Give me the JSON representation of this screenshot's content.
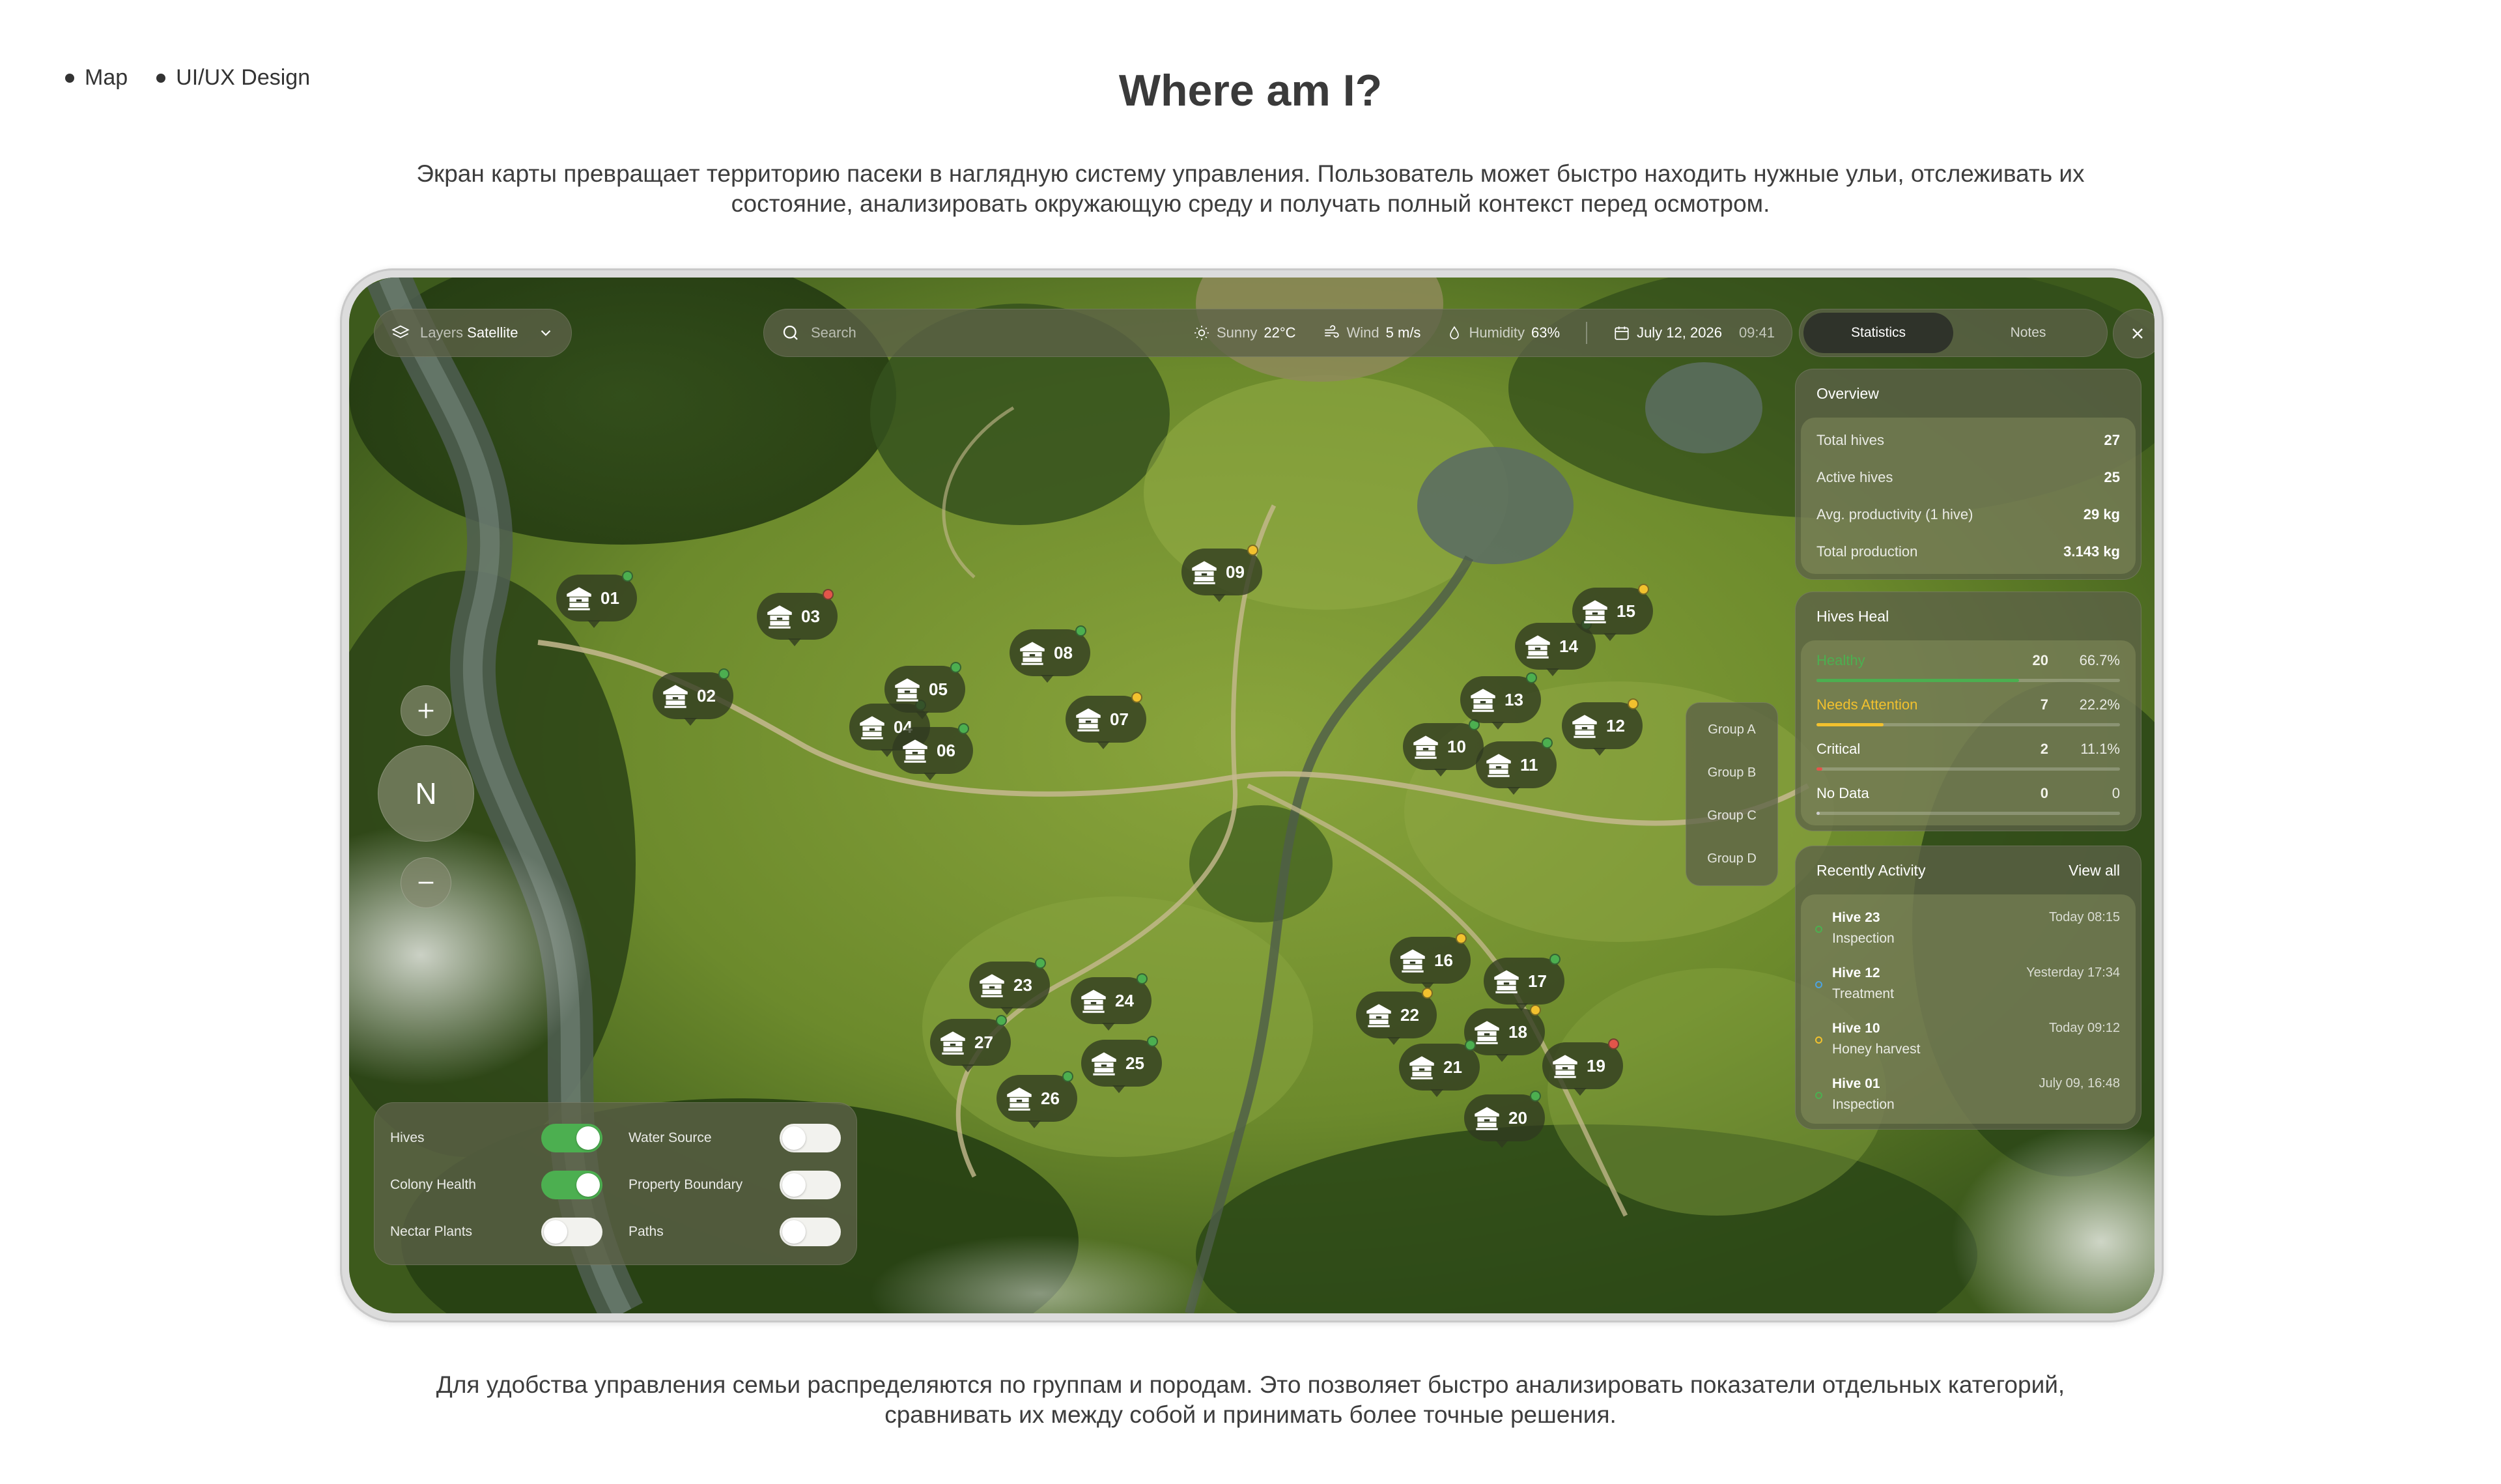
{
  "header": {
    "tags": [
      "Map",
      "UI/UX Design"
    ],
    "title": "Where am I?",
    "intro": "Экран карты превращает территорию пасеки в наглядную систему управления. Пользователь может быстро находить нужные ульи, отслеживать их состояние, анализировать окружающую среду и получать полный контекст перед осмотром.",
    "outro": "Для удобства управления семьи распределяются по группам и породам. Это позволяет быстро анализировать показатели отдельных категорий, сравнивать их между собой и принимать более точные решения."
  },
  "topbar": {
    "layers_label": "Layers",
    "layers_value": "Satellite",
    "search_placeholder": "Search",
    "weather": {
      "condition_label": "Sunny",
      "condition_value": "22°C",
      "wind_label": "Wind",
      "wind_value": "5 m/s",
      "humidity_label": "Humidity",
      "humidity_value": "63%"
    },
    "date": "July 12, 2026",
    "time": "09:41",
    "tabs": [
      {
        "label": "Statistics",
        "active": true
      },
      {
        "label": "Notes",
        "active": false
      }
    ]
  },
  "overview": {
    "title": "Overview",
    "rows": [
      {
        "label": "Total hives",
        "value": "27"
      },
      {
        "label": "Active hives",
        "value": "25"
      },
      {
        "label": "Avg. productivity (1 hive)",
        "value": "29 kg"
      },
      {
        "label": "Total production",
        "value": "3.143 kg"
      }
    ]
  },
  "health": {
    "title": "Hives Heal",
    "rows": [
      {
        "label": "Healthy",
        "count": "20",
        "pct": "66.7%",
        "fraction": 0.667,
        "color": "#4caf50"
      },
      {
        "label": "Needs Attention",
        "count": "7",
        "pct": "22.2%",
        "fraction": 0.222,
        "color": "#f2c12e"
      },
      {
        "label": "Critical",
        "count": "2",
        "pct": "11.1%",
        "fraction": 0.02,
        "color": "#e2554a"
      },
      {
        "label": "No Data",
        "count": "0",
        "pct": "0",
        "fraction": 0.01,
        "color": "#cfcfcf"
      }
    ]
  },
  "activity": {
    "title": "Recently Activity",
    "view_all": "View all",
    "items": [
      {
        "hive": "Hive 23",
        "event": "Inspection",
        "time": "Today 08:15",
        "color": "#4caf50"
      },
      {
        "hive": "Hive 12",
        "event": "Treatment",
        "time": "Yesterday 17:34",
        "color": "#4da3e0"
      },
      {
        "hive": "Hive 10",
        "event": "Honey harvest",
        "time": "Today 09:12",
        "color": "#f2c12e"
      },
      {
        "hive": "Hive 01",
        "event": "Inspection",
        "time": "July 09, 16:48",
        "color": "#4caf50"
      }
    ]
  },
  "groups": [
    "Group A",
    "Group B",
    "Group C",
    "Group D"
  ],
  "compass": "N",
  "layer_toggles": {
    "left": [
      {
        "label": "Hives",
        "on": true
      },
      {
        "label": "Colony Health",
        "on": true
      },
      {
        "label": "Nectar Plants",
        "on": false
      }
    ],
    "right": [
      {
        "label": "Water Source",
        "on": false
      },
      {
        "label": "Property Boundary",
        "on": false
      },
      {
        "label": "Paths",
        "on": false
      }
    ]
  },
  "hives": [
    {
      "id": "01",
      "status": "healthy"
    },
    {
      "id": "02",
      "status": "healthy"
    },
    {
      "id": "03",
      "status": "critical"
    },
    {
      "id": "04",
      "status": "healthy"
    },
    {
      "id": "05",
      "status": "healthy"
    },
    {
      "id": "06",
      "status": "healthy"
    },
    {
      "id": "07",
      "status": "attention"
    },
    {
      "id": "08",
      "status": "healthy"
    },
    {
      "id": "09",
      "status": "attention"
    },
    {
      "id": "10",
      "status": "healthy"
    },
    {
      "id": "11",
      "status": "healthy"
    },
    {
      "id": "12",
      "status": "attention"
    },
    {
      "id": "13",
      "status": "healthy"
    },
    {
      "id": "14",
      "status": "healthy"
    },
    {
      "id": "15",
      "status": "attention"
    },
    {
      "id": "16",
      "status": "attention"
    },
    {
      "id": "17",
      "status": "healthy"
    },
    {
      "id": "18",
      "status": "attention"
    },
    {
      "id": "19",
      "status": "critical"
    },
    {
      "id": "20",
      "status": "healthy"
    },
    {
      "id": "21",
      "status": "healthy"
    },
    {
      "id": "22",
      "status": "attention"
    },
    {
      "id": "23",
      "status": "healthy"
    },
    {
      "id": "24",
      "status": "healthy"
    },
    {
      "id": "25",
      "status": "healthy"
    },
    {
      "id": "26",
      "status": "healthy"
    },
    {
      "id": "27",
      "status": "healthy"
    }
  ],
  "status_colors": {
    "healthy": "#4caf50",
    "attention": "#f2c12e",
    "critical": "#e2554a"
  }
}
